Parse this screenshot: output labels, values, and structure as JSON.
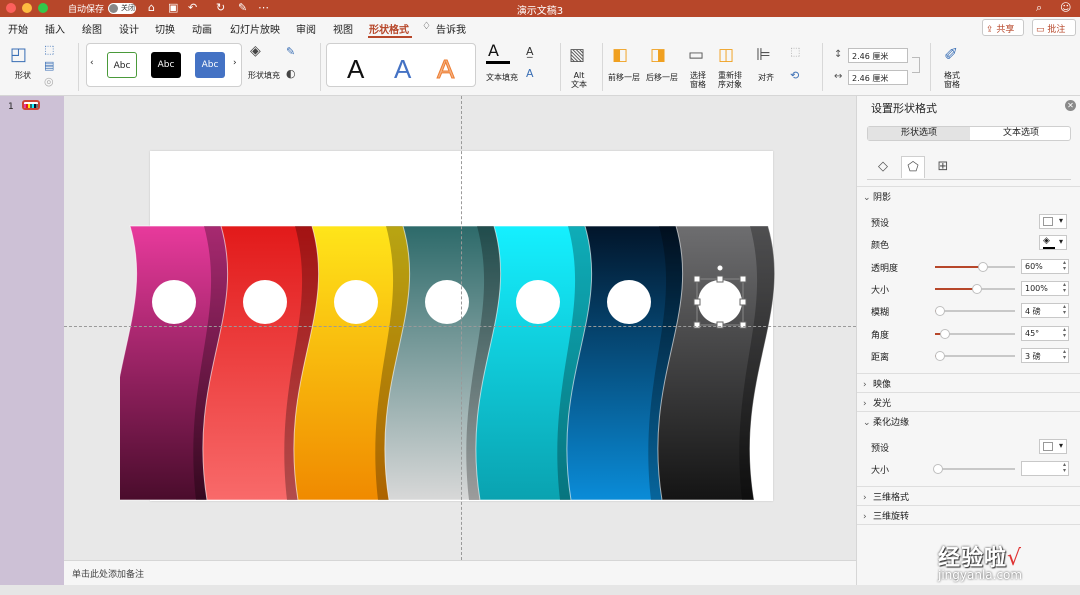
{
  "titlebar": {
    "autosave_label": "自动保存",
    "autosave_state": "关闭",
    "doc_title": "演示文稿3"
  },
  "menu": {
    "tabs": [
      "开始",
      "插入",
      "绘图",
      "设计",
      "切换",
      "动画",
      "幻灯片放映",
      "审阅",
      "视图",
      "形状格式"
    ],
    "active_tab": "形状格式",
    "tell_me": "告诉我",
    "share": "共享",
    "comment": "批注"
  },
  "ribbon": {
    "shape_label": "形状",
    "style_swatches": [
      "Abc",
      "Abc",
      "Abc"
    ],
    "shape_fill": "形状填充",
    "text_fill": "文本填充",
    "alt_text": "Alt\n文本",
    "bring_forward": "前移一层",
    "send_backward": "后移一层",
    "selection_pane": "选择\n窗格",
    "reorder": "重新排\n序对象",
    "align": "对齐",
    "height": "2.46 厘米",
    "width": "2.46 厘米",
    "format_pane": "格式\n窗格"
  },
  "slides": {
    "number": "1"
  },
  "notes_placeholder": "单击此处添加备注",
  "format_pane": {
    "title": "设置形状格式",
    "tabs": [
      "形状选项",
      "文本选项"
    ],
    "shadow_section": "阴影",
    "shadow_fields": {
      "preset": "预设",
      "color": "颜色",
      "transparency": "透明度",
      "transparency_value": "60%",
      "size": "大小",
      "size_value": "100%",
      "blur": "模糊",
      "blur_value": "4 磅",
      "angle": "角度",
      "angle_value": "45°",
      "distance": "距离",
      "distance_value": "3 磅"
    },
    "shadow_levels": {
      "transparency": 0.6,
      "size": 0.52,
      "blur": 0.06,
      "angle": 0.13,
      "distance": 0.06
    },
    "reflection": "映像",
    "glow": "发光",
    "soft_edges": "柔化边缘",
    "soft_preset": "预设",
    "soft_size": "大小",
    "format_3d": "三维格式",
    "rotation_3d": "三维旋转"
  },
  "colors": {
    "accent": "#b7472a",
    "strips": [
      {
        "top": "#e83a9c",
        "bottom": "#4a0c2c"
      },
      {
        "top": "#e21a1a",
        "bottom": "#f86a6a"
      },
      {
        "top": "#ffe51a",
        "bottom": "#f08a00"
      },
      {
        "top": "#2d6a6a",
        "bottom": "#d8d8d8"
      },
      {
        "top": "#15f0ff",
        "bottom": "#0aa2b0"
      },
      {
        "top": "#02152a",
        "bottom": "#0a8cd8"
      },
      {
        "top": "#6e6e70",
        "bottom": "#141414"
      }
    ]
  },
  "watermark": {
    "brand": "经验啦",
    "check": "√",
    "site": "jingyanla.com"
  }
}
